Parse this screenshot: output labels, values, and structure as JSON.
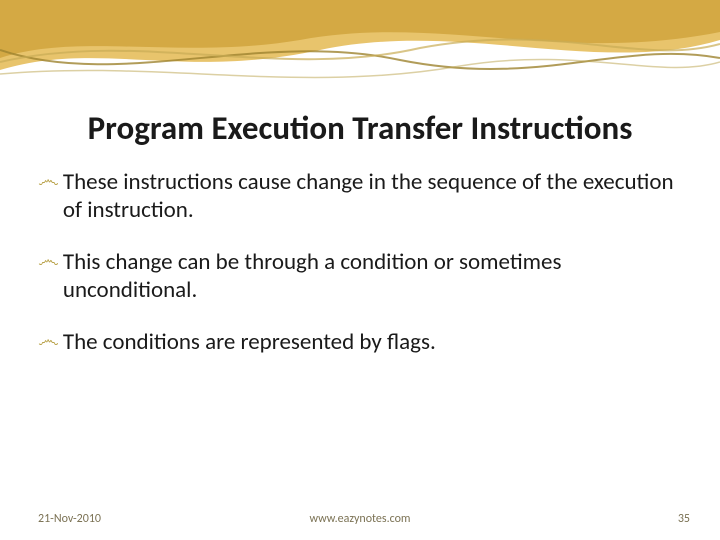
{
  "slide": {
    "title": "Program Execution Transfer Instructions",
    "bullets": [
      "These instructions cause change in the sequence of the execution of instruction.",
      "This change can be through a condition or sometimes unconditional.",
      "The conditions are represented by flags."
    ],
    "footer": {
      "date": "21-Nov-2010",
      "site": "www.eazynotes.com",
      "page": "35"
    }
  }
}
